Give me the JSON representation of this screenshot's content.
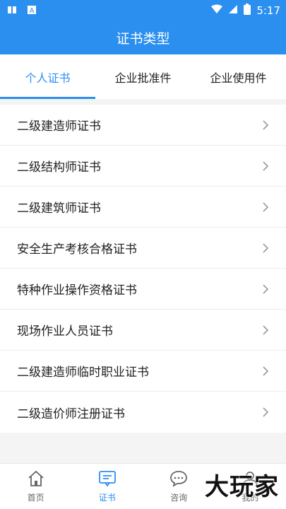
{
  "status": {
    "time": "5:17"
  },
  "header": {
    "title": "证书类型"
  },
  "tabs": [
    {
      "label": "个人证书",
      "active": true
    },
    {
      "label": "企业批准件",
      "active": false
    },
    {
      "label": "企业使用件",
      "active": false
    }
  ],
  "list": {
    "items": [
      {
        "label": "二级建造师证书"
      },
      {
        "label": "二级结构师证书"
      },
      {
        "label": "二级建筑师证书"
      },
      {
        "label": "安全生产考核合格证书"
      },
      {
        "label": "特种作业操作资格证书"
      },
      {
        "label": "现场作业人员证书"
      },
      {
        "label": "二级建造师临时职业证书"
      },
      {
        "label": "二级造价师注册证书"
      }
    ]
  },
  "bottom_nav": [
    {
      "label": "首页",
      "icon": "home-icon",
      "active": false
    },
    {
      "label": "证书",
      "icon": "certificate-icon",
      "active": true
    },
    {
      "label": "咨询",
      "icon": "chat-icon",
      "active": false
    },
    {
      "label": "我的",
      "icon": "user-icon",
      "active": false
    }
  ],
  "watermark": {
    "text": "大玩家"
  },
  "colors": {
    "primary": "#2b8ff0",
    "text": "#222222",
    "muted": "#666666"
  }
}
